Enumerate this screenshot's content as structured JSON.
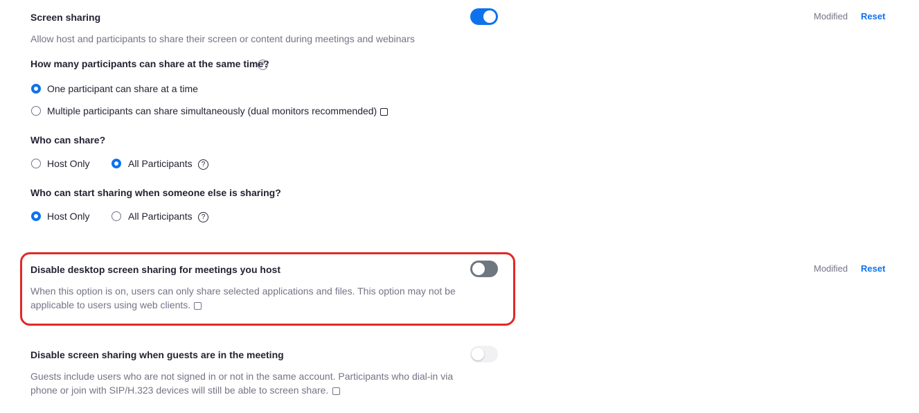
{
  "settings": {
    "screen_sharing": {
      "title": "Screen sharing",
      "description": "Allow host and participants to share their screen or content during meetings and webinars",
      "toggle_state": "on",
      "modified_label": "Modified",
      "reset_label": "Reset",
      "q_how_many": "How many participants can share at the same time?",
      "opt_one": "One participant can share at a time",
      "opt_multiple": "Multiple participants can share simultaneously (dual monitors recommended)",
      "q_who_can_share": "Who can share?",
      "who_can_share_options": [
        "Host Only",
        "All Participants"
      ],
      "who_can_share_selected": "All Participants",
      "q_who_can_start": "Who can start sharing when someone else is sharing?",
      "who_can_start_options": [
        "Host Only",
        "All Participants"
      ],
      "who_can_start_selected": "Host Only"
    },
    "disable_desktop": {
      "title": "Disable desktop screen sharing for meetings you host",
      "description_line1": "When this option is on, users can only share selected applications and files. This option may not be",
      "description_line2": "applicable to users using web clients.",
      "toggle_state": "off",
      "modified_label": "Modified",
      "reset_label": "Reset"
    },
    "disable_guests": {
      "title": "Disable screen sharing when guests are in the meeting",
      "description_line1": "Guests include users who are not signed in or not in the same account. Participants who dial-in via",
      "description_line2": "phone or join with SIP/H.323 devices will still be able to screen share.",
      "toggle_state": "disabled"
    }
  },
  "icons": {
    "help": "?"
  },
  "colors": {
    "accent": "#0e72ed",
    "highlight": "#e02828",
    "muted_text": "#747487"
  }
}
